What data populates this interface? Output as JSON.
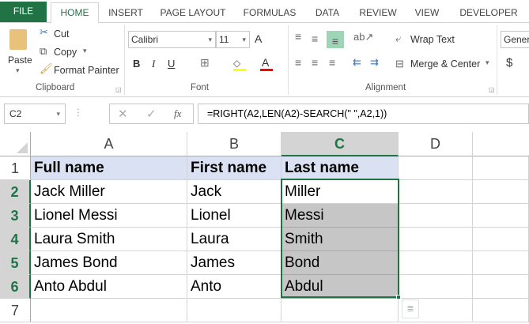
{
  "tabs": [
    "FILE",
    "HOME",
    "INSERT",
    "PAGE LAYOUT",
    "FORMULAS",
    "DATA",
    "REVIEW",
    "VIEW",
    "DEVELOPER"
  ],
  "ribbon": {
    "clipboard": {
      "paste": "Paste",
      "cut": "Cut",
      "copy": "Copy",
      "format_painter": "Format Painter",
      "label": "Clipboard"
    },
    "font": {
      "name": "Calibri",
      "size": "11",
      "bold": "B",
      "italic": "I",
      "underline": "U",
      "label": "Font",
      "fill_color": "#ffff00",
      "font_color": "#ff0000"
    },
    "alignment": {
      "wrap_text": "Wrap Text",
      "merge_center": "Merge & Center",
      "label": "Alignment"
    },
    "number": {
      "format": "General",
      "currency": "$"
    }
  },
  "formula_bar": {
    "name_box": "C2",
    "fx": "fx",
    "formula": "=RIGHT(A2,LEN(A2)-SEARCH(\" \",A2,1))"
  },
  "grid": {
    "columns": [
      "A",
      "B",
      "C",
      "D"
    ],
    "rows": [
      "1",
      "2",
      "3",
      "4",
      "5",
      "6",
      "7"
    ],
    "cells": [
      [
        "Full name",
        "First name",
        "Last name"
      ],
      [
        "Jack Miller",
        "Jack",
        "Miller"
      ],
      [
        "Lionel Messi",
        "Lionel",
        "Messi"
      ],
      [
        "Laura Smith",
        "Laura",
        "Smith"
      ],
      [
        "James Bond",
        "James",
        "Bond"
      ],
      [
        "Anto Abdul",
        "Anto",
        "Abdul"
      ]
    ],
    "active_cell": "C2",
    "selection": "C2:C6",
    "accent": "#217346",
    "header_fill": "#d9e1f2"
  }
}
